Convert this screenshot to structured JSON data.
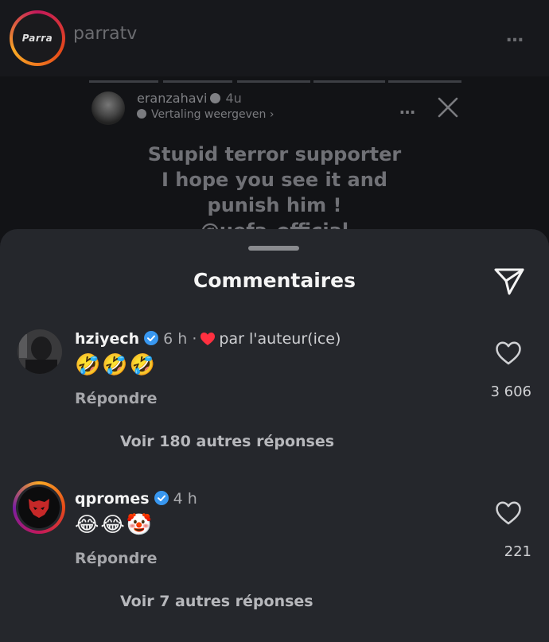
{
  "post": {
    "avatar_text": "Parra",
    "username": "parratv",
    "menu_icon": "…"
  },
  "story": {
    "username": "eranzahavi",
    "time": "4u",
    "translate_label": "Vertaling weergeven",
    "translate_chevron": "›",
    "more_icon": "…",
    "text_lines": [
      "Stupid terror supporter",
      "I hope you see it and",
      "punish him !",
      "@uefa_official"
    ]
  },
  "comments_sheet": {
    "title": "Commentaires",
    "comments": [
      {
        "username": "hziyech",
        "time": "6 h ·",
        "liked_by_author": "par l'auteur(ice)",
        "text": "🤣🤣🤣",
        "reply_label": "Répondre",
        "likes": "3 606",
        "view_more": "Voir 180 autres réponses"
      },
      {
        "username": "qpromes",
        "time": "4 h",
        "text": "😂😂🤡",
        "reply_label": "Répondre",
        "likes": "221",
        "view_more": "Voir 7 autres réponses"
      }
    ]
  },
  "colors": {
    "sheet_bg": "#25272c",
    "verified_blue": "#3897f0",
    "heart_red": "#ff3040"
  }
}
